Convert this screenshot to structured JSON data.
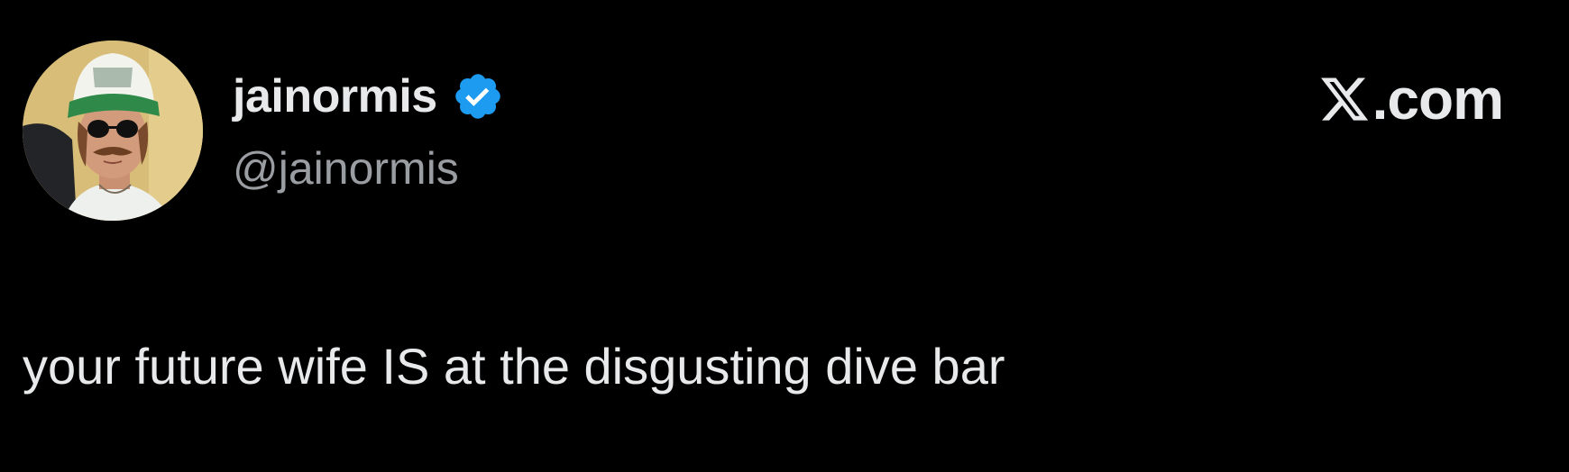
{
  "author": {
    "display_name": "jainormis",
    "handle": "@jainormis",
    "verified": true,
    "avatar_icon": "profile-photo"
  },
  "site": {
    "logo_icon": "x-logo-icon",
    "label": ".com"
  },
  "tweet": {
    "text": "your future wife IS at the disgusting dive bar"
  },
  "colors": {
    "background": "#000000",
    "primary_text": "#e7e9ea",
    "secondary_text": "#9a9ea2",
    "verified_blue": "#1d9bf0"
  }
}
